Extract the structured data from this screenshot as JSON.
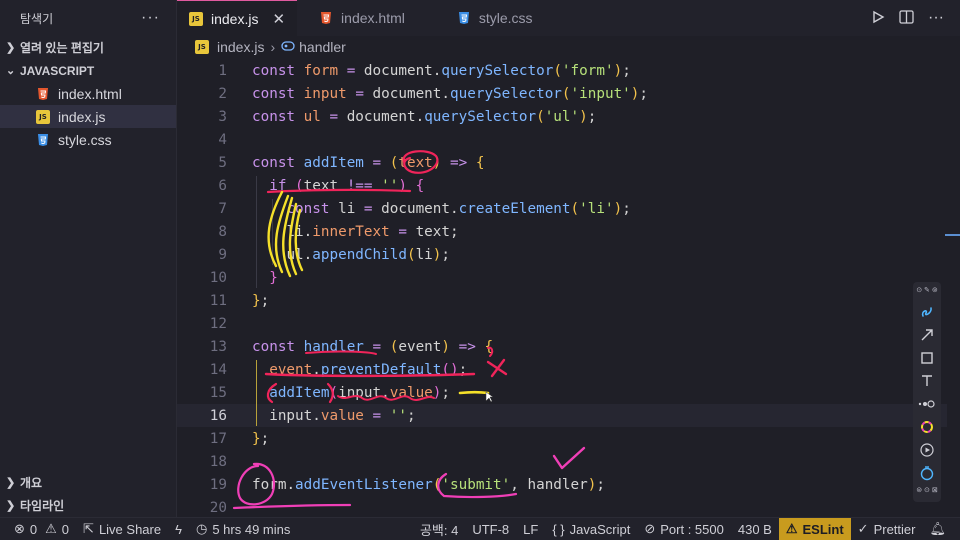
{
  "sidebar": {
    "title": "탐색기",
    "more": "···",
    "open_editors": "열려 있는 편집기",
    "folder": "JAVASCRIPT",
    "files": [
      {
        "name": "index.html",
        "icon": "html-file-icon"
      },
      {
        "name": "index.js",
        "icon": "js-file-icon"
      },
      {
        "name": "style.css",
        "icon": "css-file-icon"
      }
    ],
    "outline": "개요",
    "timeline": "타임라인"
  },
  "tabs": [
    {
      "label": "index.js",
      "close": "✕"
    },
    {
      "label": "index.html"
    },
    {
      "label": "style.css"
    }
  ],
  "breadcrumb": {
    "file": "index.js",
    "sep": "›",
    "symbol": "handler"
  },
  "editor": {
    "line_numbers": [
      "1",
      "2",
      "3",
      "4",
      "5",
      "6",
      "7",
      "8",
      "9",
      "10",
      "11",
      "12",
      "13",
      "14",
      "15",
      "16",
      "17",
      "18",
      "19",
      "20"
    ],
    "current_line": 16
  },
  "status": {
    "errors": "0",
    "warnings": "0",
    "live_share": "Live Share",
    "time": "5 hrs 49 mins",
    "spaces": "공백: 4",
    "encoding": "UTF-8",
    "eol": "LF",
    "language": "JavaScript",
    "port": "Port : 5500",
    "size": "430 B",
    "eslint": "ESLint",
    "prettier": "Prettier"
  },
  "colors": {
    "accent_tab": "#e05a9f",
    "eslint_bg": "#c89b1e",
    "ink_red": "#f0245a",
    "ink_yellow": "#f5e02a",
    "ink_magenta": "#f03fb7"
  }
}
